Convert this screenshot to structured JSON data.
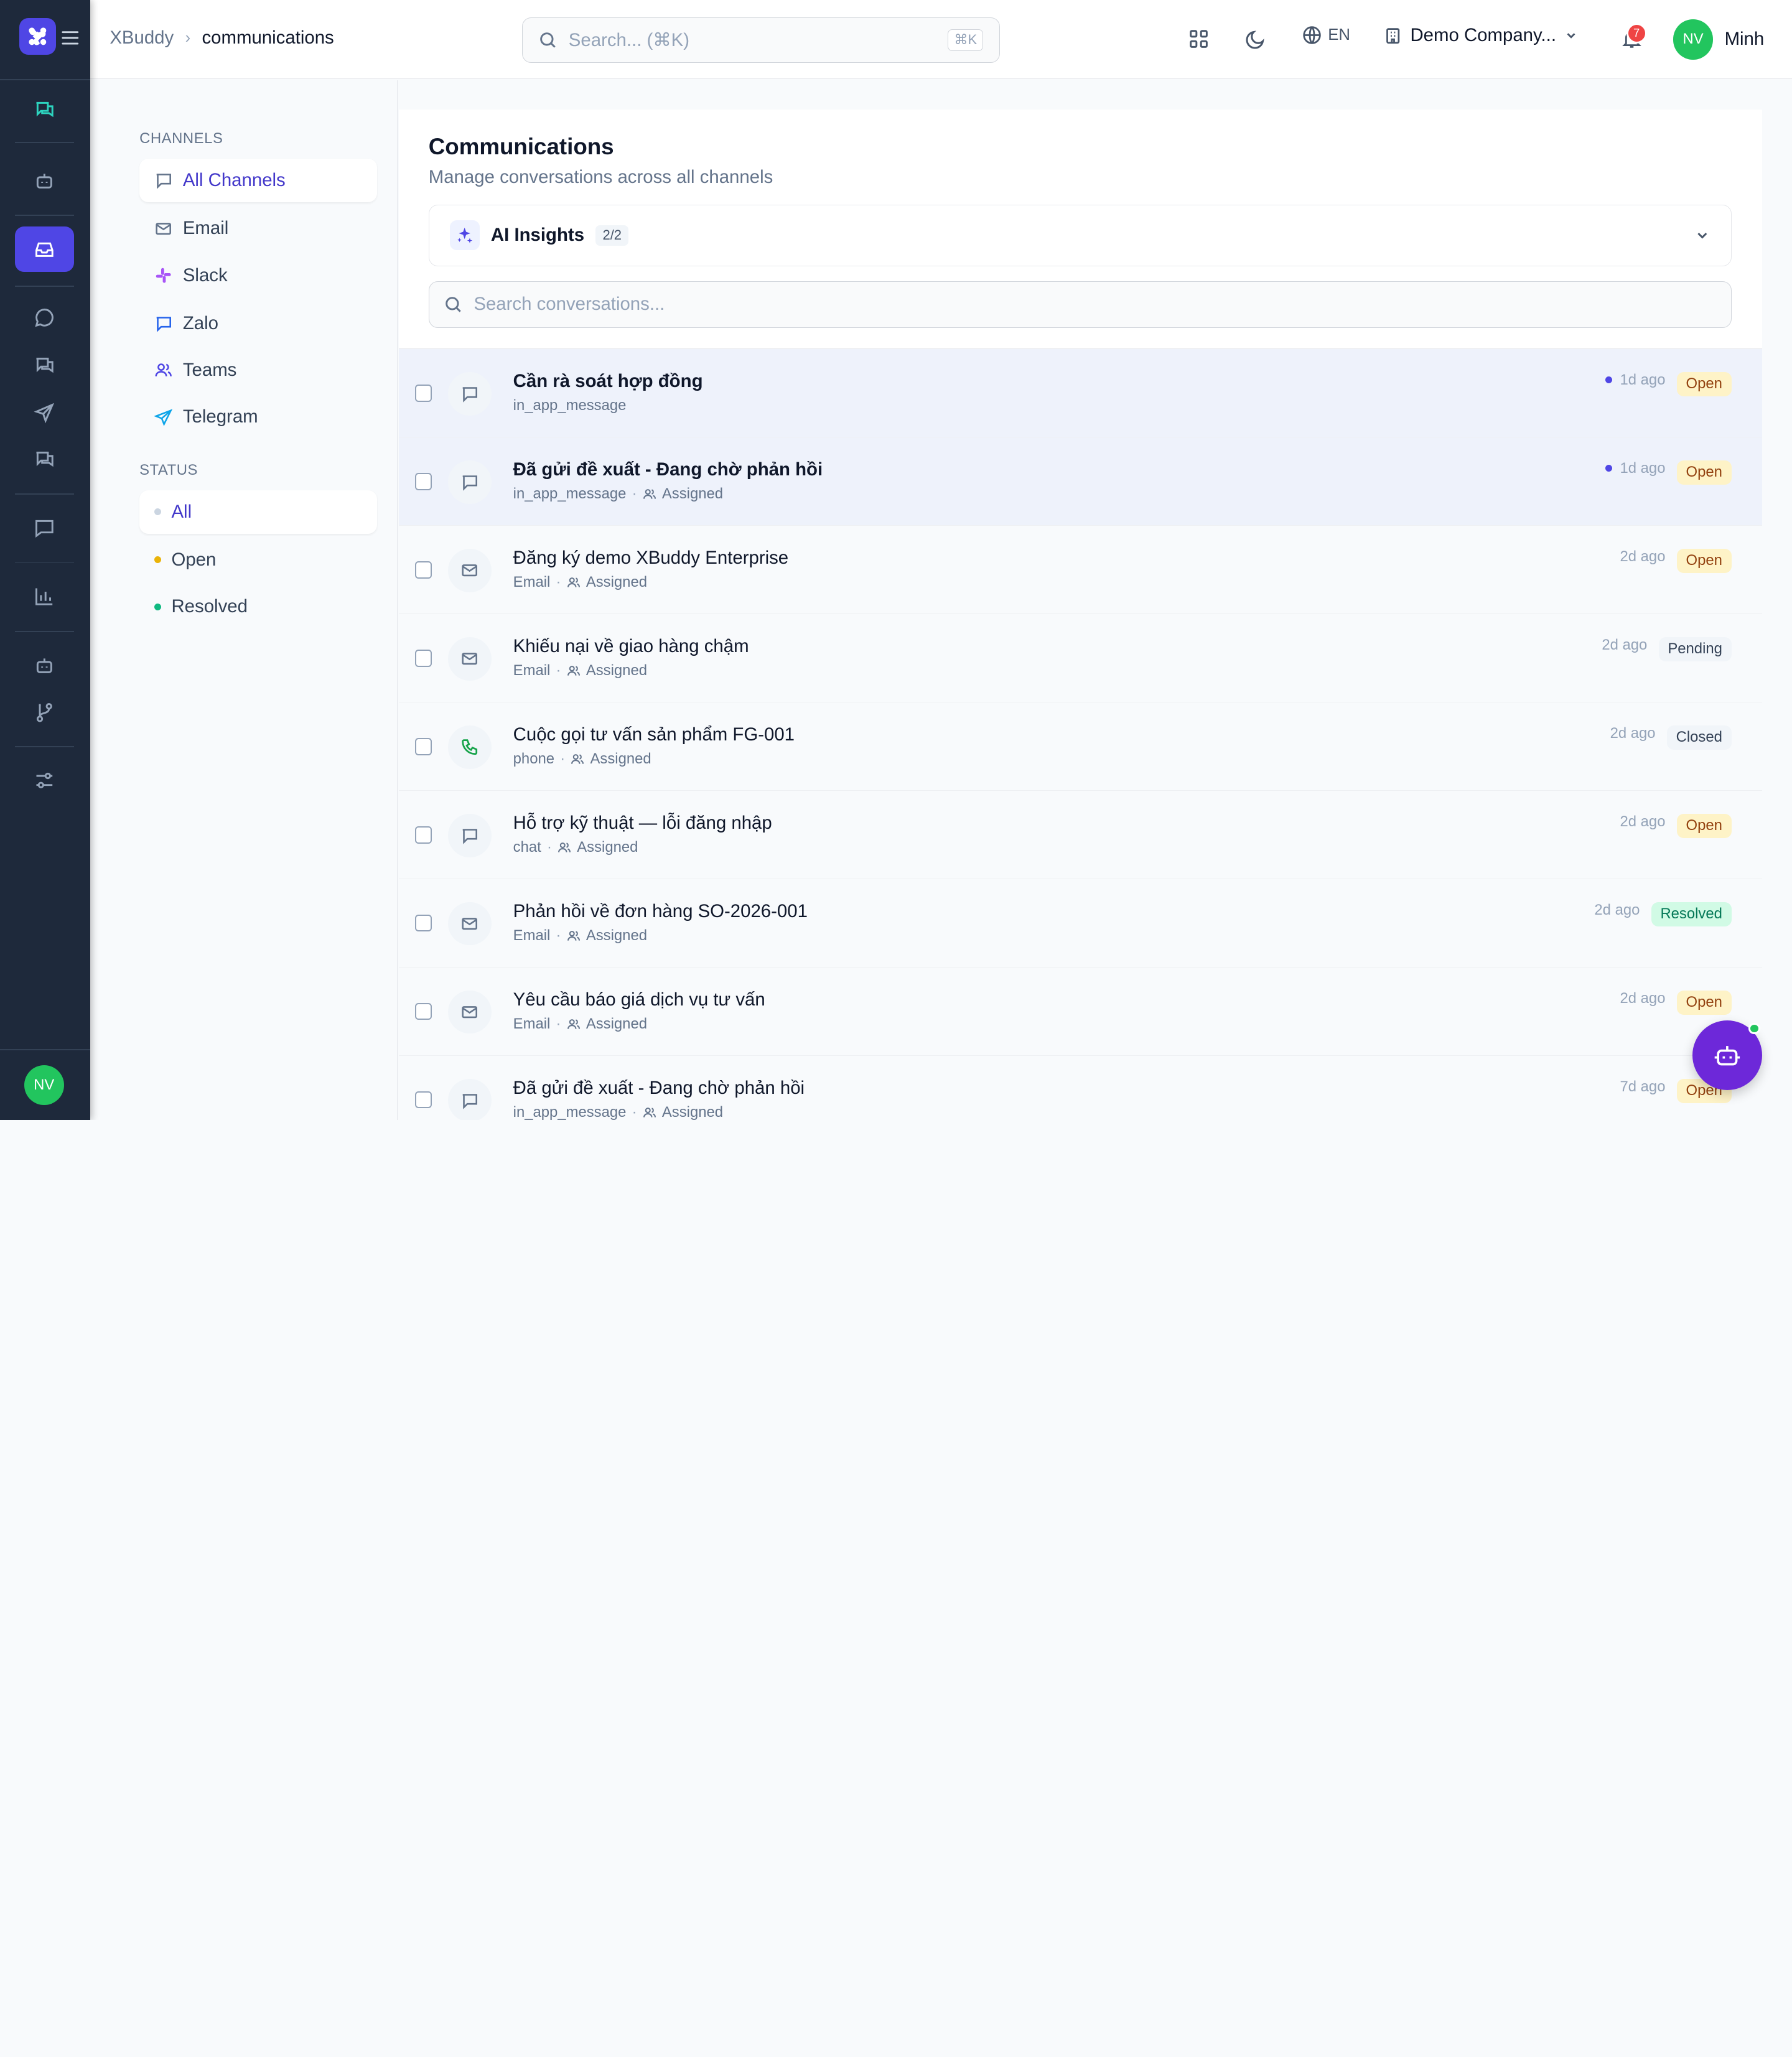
{
  "rail": {
    "avatar": "NV",
    "items": [
      {
        "name": "rail-chat-icon",
        "icon": "chat-bubbles-icon"
      },
      {
        "name": "rail-bot-icon",
        "icon": "bot-icon"
      },
      {
        "name": "rail-inbox-icon",
        "icon": "inbox-icon"
      },
      {
        "name": "rail-message-icon",
        "icon": "message-circle-icon"
      },
      {
        "name": "rail-messages-icon",
        "icon": "messages-icon"
      },
      {
        "name": "rail-send-icon",
        "icon": "send-icon"
      },
      {
        "name": "rail-conversations-icon",
        "icon": "messages-icon"
      },
      {
        "name": "rail-comment-icon",
        "icon": "comment-icon"
      },
      {
        "name": "rail-chart-icon",
        "icon": "bar-chart-icon"
      },
      {
        "name": "rail-bot2-icon",
        "icon": "bot-icon"
      },
      {
        "name": "rail-branch-icon",
        "icon": "git-branch-icon"
      },
      {
        "name": "rail-settings-icon",
        "icon": "sliders-icon"
      }
    ],
    "active_item": "inbox-icon",
    "accent": "#4f46e5"
  },
  "header": {
    "breadcrumb": [
      "XBuddy",
      "communications"
    ],
    "search_placeholder": "Search... (⌘K)",
    "search_shortcut": "⌘K",
    "language": "EN",
    "company": "Demo Company...",
    "notification_count": "7",
    "user_initials": "NV",
    "user_name": "Minh"
  },
  "sidebar": {
    "channels_title": "CHANNELS",
    "channels": [
      {
        "label": "All Channels",
        "icon": "message-square-icon",
        "active": true
      },
      {
        "label": "Email",
        "icon": "mail-icon"
      },
      {
        "label": "Slack",
        "icon": "slack-icon"
      },
      {
        "label": "Zalo",
        "icon": "message-square-icon"
      },
      {
        "label": "Teams",
        "icon": "users-icon"
      },
      {
        "label": "Telegram",
        "icon": "send-icon"
      }
    ],
    "status_title": "STATUS",
    "statuses": [
      {
        "label": "All",
        "color": "#cbd5e1",
        "active": true
      },
      {
        "label": "Open",
        "color": "#eab308"
      },
      {
        "label": "Resolved",
        "color": "#10b981"
      }
    ]
  },
  "main": {
    "title": "Communications",
    "subtitle": "Manage conversations across all channels",
    "insights_label": "AI Insights",
    "insights_count": "2/2",
    "search_placeholder": "Search conversations...",
    "conversations": [
      {
        "title": "Cần rà soát hợp đồng",
        "channel": "in_app_message",
        "assigned": "",
        "time": "1d ago",
        "status": "Open",
        "status_type": "open",
        "unread": true,
        "icon": "message-square-icon"
      },
      {
        "title": "Đã gửi đề xuất - Đang chờ phản hồi",
        "channel": "in_app_message",
        "assigned": "Assigned",
        "time": "1d ago",
        "status": "Open",
        "status_type": "open",
        "unread": true,
        "icon": "message-square-icon"
      },
      {
        "title": "Đăng ký demo XBuddy Enterprise",
        "channel": "Email",
        "assigned": "Assigned",
        "time": "2d ago",
        "status": "Open",
        "status_type": "open",
        "unread": false,
        "icon": "mail-icon"
      },
      {
        "title": "Khiếu nại về giao hàng chậm",
        "channel": "Email",
        "assigned": "Assigned",
        "time": "2d ago",
        "status": "Pending",
        "status_type": "pending",
        "unread": false,
        "icon": "mail-icon"
      },
      {
        "title": "Cuộc gọi tư vấn sản phẩm FG-001",
        "channel": "phone",
        "assigned": "Assigned",
        "time": "2d ago",
        "status": "Closed",
        "status_type": "closed",
        "unread": false,
        "icon": "phone-icon"
      },
      {
        "title": "Hỗ trợ kỹ thuật — lỗi đăng nhập",
        "channel": "chat",
        "assigned": "Assigned",
        "time": "2d ago",
        "status": "Open",
        "status_type": "open",
        "unread": false,
        "icon": "message-square-icon"
      },
      {
        "title": "Phản hồi về đơn hàng SO-2026-001",
        "channel": "Email",
        "assigned": "Assigned",
        "time": "2d ago",
        "status": "Resolved",
        "status_type": "resolved",
        "unread": false,
        "icon": "mail-icon"
      },
      {
        "title": "Yêu cầu báo giá dịch vụ tư vấn",
        "channel": "Email",
        "assigned": "Assigned",
        "time": "2d ago",
        "status": "Open",
        "status_type": "open",
        "unread": false,
        "icon": "mail-icon"
      },
      {
        "title": "Đã gửi đề xuất - Đang chờ phản hồi",
        "channel": "in_app_message",
        "assigned": "Assigned",
        "time": "7d ago",
        "status": "Open",
        "status_type": "open",
        "unread": false,
        "icon": "message-square-icon"
      }
    ]
  }
}
